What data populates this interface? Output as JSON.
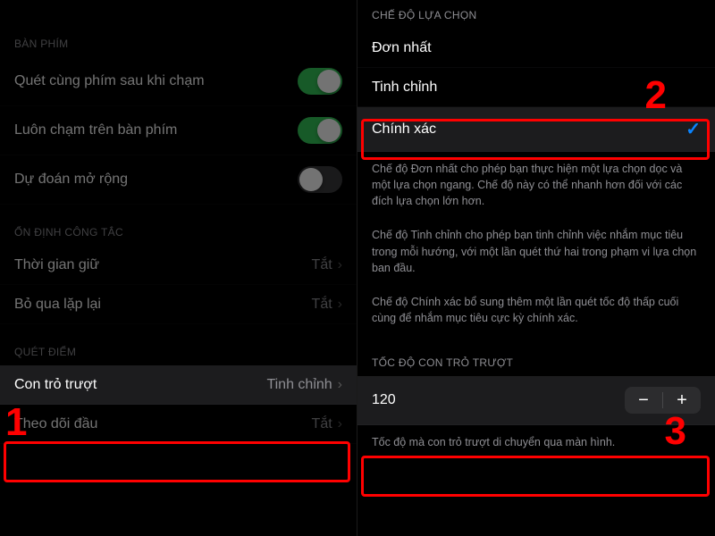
{
  "left": {
    "sections": {
      "keyboard": {
        "header": "BÀN PHÍM",
        "scan_after_tap": {
          "label": "Quét cùng phím sau khi chạm",
          "on": true
        },
        "always_tap": {
          "label": "Luôn chạm trên bàn phím",
          "on": true
        },
        "extended_predict": {
          "label": "Dự đoán mở rộng",
          "on": false
        }
      },
      "switch_stab": {
        "header": "ỔN ĐỊNH CÔNG TẮC",
        "hold_duration": {
          "label": "Thời gian giữ",
          "value": "Tắt"
        },
        "ignore_repeat": {
          "label": "Bỏ qua lặp lại",
          "value": "Tắt"
        }
      },
      "point_scan": {
        "header": "QUÉT ĐIỂM",
        "gliding_cursor": {
          "label": "Con trỏ trượt",
          "value": "Tinh chỉnh"
        },
        "head_tracking": {
          "label": "Theo dõi đầu",
          "value": "Tắt"
        }
      }
    }
  },
  "right": {
    "selection_mode": {
      "header": "CHẾ ĐỘ LỰA CHỌN",
      "single": {
        "label": "Đơn nhất",
        "selected": false
      },
      "refined": {
        "label": "Tinh chỉnh",
        "selected": false
      },
      "precise": {
        "label": "Chính xác",
        "selected": true
      },
      "desc1": "Chế độ Đơn nhất cho phép bạn thực hiện một lựa chọn dọc và một lựa chọn ngang. Chế độ này có thể nhanh hơn đối với các đích lựa chọn lớn hơn.",
      "desc2": "Chế độ Tinh chỉnh cho phép bạn tinh chỉnh việc nhắm mục tiêu trong mỗi hướng, với một lần quét thứ hai trong phạm vi lựa chọn ban đầu.",
      "desc3": "Chế độ Chính xác bổ sung thêm một lần quét tốc độ thấp cuối cùng để nhắm mục tiêu cực kỳ chính xác."
    },
    "cursor_speed": {
      "header": "TỐC ĐỘ CON TRỎ TRƯỢT",
      "value": "120",
      "footer": "Tốc độ mà con trỏ trượt di chuyển qua màn hình."
    }
  },
  "annotations": {
    "n1": "1",
    "n2": "2",
    "n3": "3"
  }
}
